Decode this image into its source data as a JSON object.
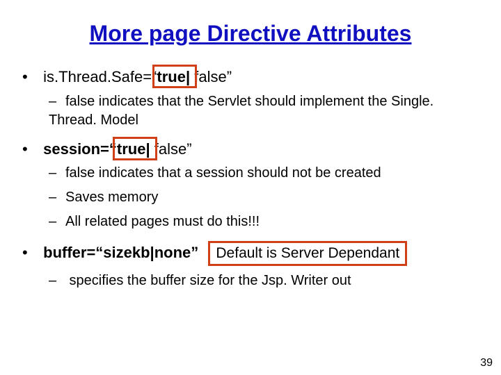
{
  "title": "More page Directive Attributes",
  "bullets": {
    "b1a_pre": "is",
    "b1a_mid": "Thread",
    "b1a_eq": "Safe=“",
    "b1a_true": "true",
    "b1a_rest": " false”",
    "b1a_sub": "false indicates that the Servlet should implement the Single. Thread. Model",
    "b2_pre": "session=“",
    "b2_true": "true",
    "b2_rest": " false”",
    "b2_sub1": "false indicates that a session should not be created",
    "b2_sub2": "Saves memory",
    "b2_sub3": "All related pages must do this!!!",
    "b3_label": "buffer=“sizekb|none”",
    "b3_callout": "Default is Server Dependant",
    "b3_sub": " specifies the buffer size for the Jsp. Writer out"
  },
  "page_number": "39"
}
